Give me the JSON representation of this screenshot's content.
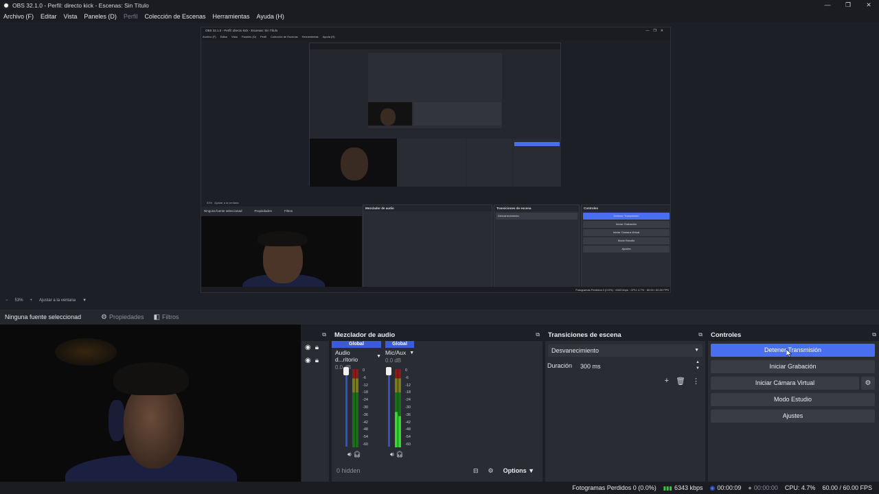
{
  "window": {
    "title": "OBS 32.1.0 - Perfil: directo kick - Escenas: Sin Título",
    "controls": [
      "—",
      "❐",
      "✕"
    ]
  },
  "menu": [
    {
      "label": "Archivo (F)",
      "enabled": true
    },
    {
      "label": "Editar",
      "enabled": true
    },
    {
      "label": "Vista",
      "enabled": true
    },
    {
      "label": "Paneles (D)",
      "enabled": true
    },
    {
      "label": "Perfil",
      "enabled": false
    },
    {
      "label": "Colección de Escenas",
      "enabled": true
    },
    {
      "label": "Herramientas",
      "enabled": true
    },
    {
      "label": "Ayuda (H)",
      "enabled": true
    }
  ],
  "zoombar": {
    "minus": "−",
    "zoom": "53%",
    "plus": "+",
    "fit": "Ajustar a la ventana"
  },
  "sourcebar": {
    "no_source": "Ninguna fuente seleccionad",
    "properties": "Propiedades",
    "filters": "Filtros"
  },
  "mixer": {
    "title": "Mezclador de audio",
    "channels": [
      {
        "badge": "Global",
        "name": "Audio d...ritorio",
        "db": "0.0 dB"
      },
      {
        "badge": "Global",
        "name": "Mic/Aux",
        "db": "0.0 dB"
      }
    ],
    "ticks": [
      "0",
      "-6",
      "-12",
      "-18",
      "-24",
      "-30",
      "-36",
      "-42",
      "-48",
      "-54",
      "-60"
    ],
    "hidden": "0 hidden",
    "options": "Options"
  },
  "transitions": {
    "title": "Transiciones de escena",
    "selected": "Desvanecimiento",
    "duration_label": "Duración",
    "duration_value": "300 ms"
  },
  "controls": {
    "title": "Controles",
    "buttons": [
      "Detener Transmisión",
      "Iniciar Grabación",
      "Iniciar Cámara Virtual",
      "Modo Estudio",
      "Ajustes"
    ],
    "active_index": 0
  },
  "status": {
    "dropped": "Fotogramas Perdidos 0 (0.0%)",
    "bitrate": "6343 kbps",
    "stream_time": "00:00:09",
    "rec_time": "00:00:00",
    "cpu": "CPU: 4.7%",
    "fps": "60.00 / 60.00 FPS"
  },
  "colors": {
    "accent": "#4a6ef0",
    "panel": "#2a2c33",
    "background": "#1d1f26"
  }
}
